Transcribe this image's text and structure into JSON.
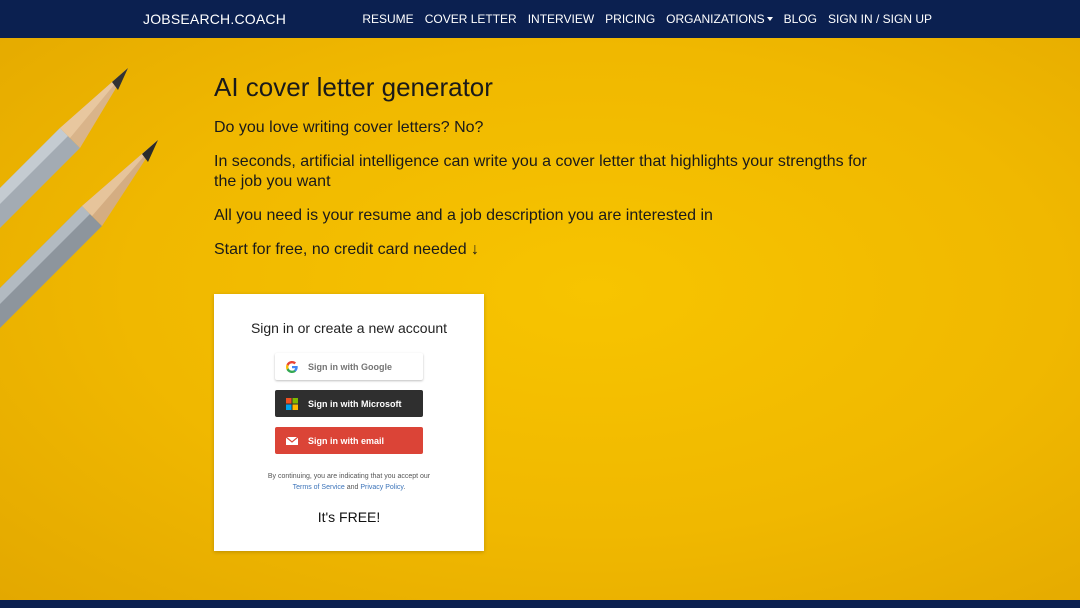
{
  "nav": {
    "brand": "JOBSEARCH.COACH",
    "links": [
      "RESUME",
      "COVER LETTER",
      "INTERVIEW",
      "PRICING",
      "ORGANIZATIONS",
      "BLOG",
      "SIGN IN / SIGN UP"
    ]
  },
  "hero": {
    "title": "AI cover letter generator",
    "lines": [
      "Do you love writing cover letters? No?",
      "In seconds, artificial intelligence can write you a cover letter that highlights your strengths for the job you want",
      "All you need is your resume and a job description you are interested in",
      "Start for free, no credit card needed ↓"
    ]
  },
  "signin": {
    "title": "Sign in or create a new account",
    "google": "Sign in with Google",
    "microsoft": "Sign in with Microsoft",
    "email": "Sign in with email",
    "terms_prefix": "By continuing, you are indicating that you accept our",
    "terms_link": "Terms of Service",
    "terms_and": "and",
    "privacy_link": "Privacy Policy",
    "terms_suffix": ".",
    "free": "It's FREE!"
  },
  "colors": {
    "navbar": "#0b2050",
    "background": "#f2b705",
    "google_btn": "#ffffff",
    "microsoft_btn": "#2f2f2f",
    "email_btn": "#db4437",
    "link": "#3b73b9"
  }
}
